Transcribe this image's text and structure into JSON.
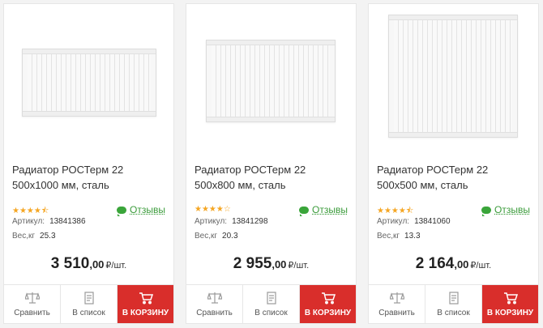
{
  "common": {
    "compare_label": "Сравнить",
    "list_label": "В список",
    "cart_label": "В КОРЗИНУ",
    "reviews_label": "Отзывы",
    "sku_label": "Артикул:",
    "weight_label": "Вес,кг",
    "unit_label": "₽/шт.",
    "accent_color": "#d92e2b",
    "reviews_color": "#3a9b3a"
  },
  "products": [
    {
      "title": "Радиатор РОСТерм 22 500x1000 мм, сталь",
      "rating": 4.5,
      "stars": "★★★★⯪",
      "sku": "13841386",
      "weight": "25.3",
      "price_main": "3 510",
      "price_cents": ",00"
    },
    {
      "title": "Радиатор РОСТерм 22 500x800 мм, сталь",
      "rating": 4,
      "stars": "★★★★☆",
      "sku": "13841298",
      "weight": "20.3",
      "price_main": "2 955",
      "price_cents": ",00"
    },
    {
      "title": "Радиатор РОСТерм 22 500x500 мм, сталь",
      "rating": 4.5,
      "stars": "★★★★⯪",
      "sku": "13841060",
      "weight": "13.3",
      "price_main": "2 164",
      "price_cents": ",00"
    }
  ]
}
